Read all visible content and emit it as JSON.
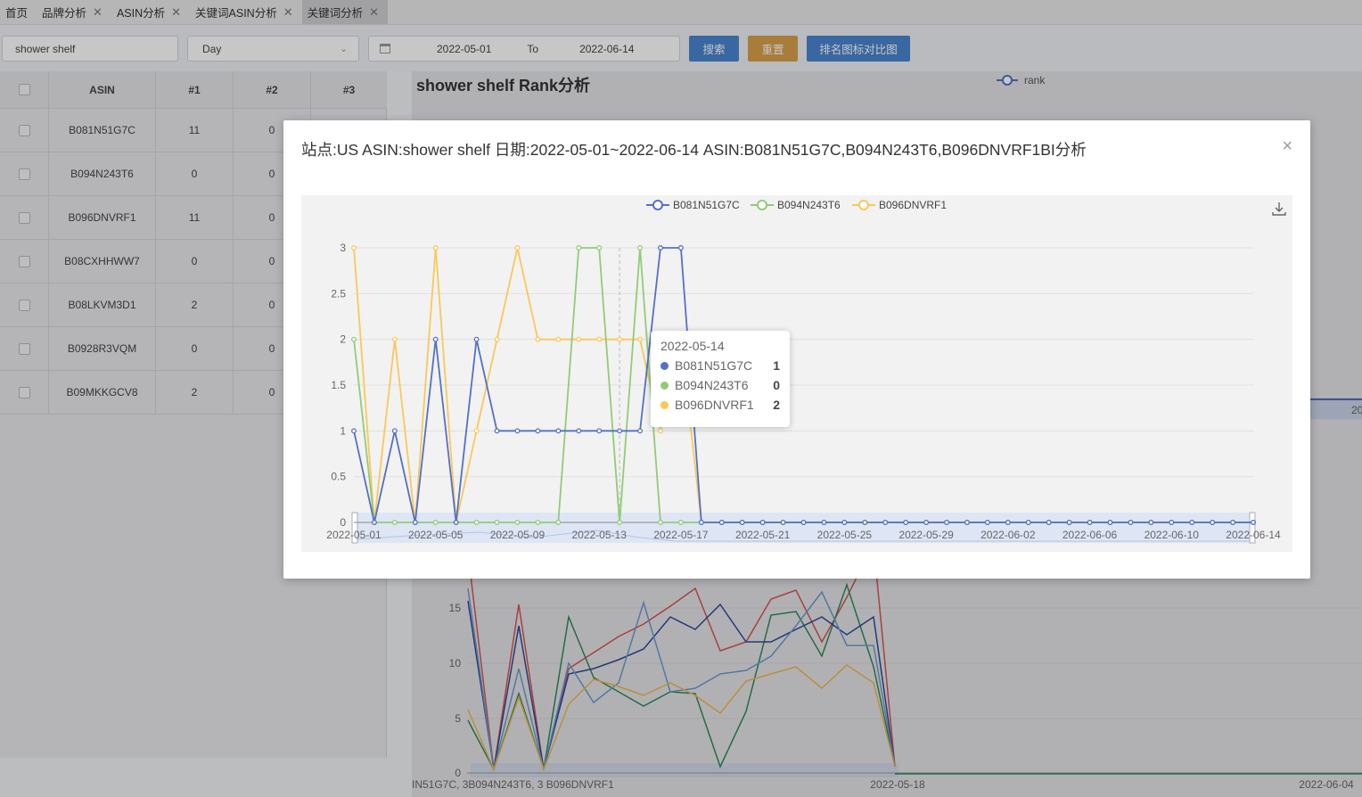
{
  "tabs": [
    {
      "label": "首页",
      "closable": false,
      "active": false
    },
    {
      "label": "品牌分析",
      "closable": true,
      "active": false
    },
    {
      "label": "ASIN分析",
      "closable": true,
      "active": false
    },
    {
      "label": "关键词ASIN分析",
      "closable": true,
      "active": false
    },
    {
      "label": "关键词分析",
      "closable": true,
      "active": true
    }
  ],
  "toolbar": {
    "keyword": "shower shelf",
    "granularity": "Day",
    "date_start": "2022-05-01",
    "date_sep": "To",
    "date_end": "2022-06-14",
    "search_label": "搜索",
    "reset_label": "重置",
    "compare_label": "排名图标对比图"
  },
  "table": {
    "headers": [
      "ASIN",
      "#1",
      "#2",
      "#3"
    ],
    "rows": [
      [
        "B081N51G7C",
        "11",
        "0"
      ],
      [
        "B094N243T6",
        "0",
        "0"
      ],
      [
        "B096DNVRF1",
        "11",
        "0"
      ],
      [
        "B08CXHHWW7",
        "0",
        "0"
      ],
      [
        "B08LKVM3D1",
        "2",
        "0"
      ],
      [
        "B0928R3VQM",
        "0",
        "0"
      ],
      [
        "B09MKKGCV8",
        "2",
        "0"
      ]
    ]
  },
  "background_chart": {
    "title": "shower shelf Rank分析",
    "legend": "rank",
    "y_ticks": [
      "15",
      "10",
      "5",
      "0"
    ],
    "x_ticks": [
      "2022-05-18",
      "2022-06-04"
    ],
    "x_partial_label": "IN51G7C, 3B094N243T6, 3 B096DNVRF1",
    "edge_label": "20"
  },
  "modal": {
    "title": "站点:US ASIN:shower shelf 日期:2022-05-01~2022-06-14 ASIN:B081N51G7C,B094N243T6,B096DNVRF1BI分析",
    "close_label": "×"
  },
  "tooltip": {
    "date": "2022-05-14",
    "items": [
      {
        "name": "B081N51G7C",
        "value": "1",
        "color": "#5470c6"
      },
      {
        "name": "B094N243T6",
        "value": "0",
        "color": "#91cc75"
      },
      {
        "name": "B096DNVRF1",
        "value": "2",
        "color": "#fac858"
      }
    ]
  },
  "chart_data": {
    "type": "line",
    "title": "",
    "xlabel": "",
    "ylabel": "",
    "ylim": [
      0,
      3
    ],
    "y_ticks": [
      0,
      0.5,
      1,
      1.5,
      2,
      2.5,
      3
    ],
    "x_tick_labels": [
      "2022-05-01",
      "2022-05-05",
      "2022-05-09",
      "2022-05-13",
      "2022-05-17",
      "2022-05-21",
      "2022-05-25",
      "2022-05-29",
      "2022-06-02",
      "2022-06-06",
      "2022-06-10",
      "2022-06-14"
    ],
    "x": [
      "2022-05-01",
      "2022-05-02",
      "2022-05-03",
      "2022-05-04",
      "2022-05-05",
      "2022-05-06",
      "2022-05-07",
      "2022-05-08",
      "2022-05-09",
      "2022-05-10",
      "2022-05-11",
      "2022-05-12",
      "2022-05-13",
      "2022-05-14",
      "2022-05-15",
      "2022-05-16",
      "2022-05-17",
      "2022-05-18",
      "2022-05-19",
      "2022-05-20",
      "2022-05-21",
      "2022-05-22",
      "2022-05-23",
      "2022-05-24",
      "2022-05-25",
      "2022-05-26",
      "2022-05-27",
      "2022-05-28",
      "2022-05-29",
      "2022-05-30",
      "2022-05-31",
      "2022-06-01",
      "2022-06-02",
      "2022-06-03",
      "2022-06-04",
      "2022-06-05",
      "2022-06-06",
      "2022-06-07",
      "2022-06-08",
      "2022-06-09",
      "2022-06-10",
      "2022-06-11",
      "2022-06-12",
      "2022-06-13",
      "2022-06-14"
    ],
    "series": [
      {
        "name": "B081N51G7C",
        "color": "#5470c6",
        "values": [
          1,
          0,
          1,
          0,
          2,
          0,
          2,
          1,
          1,
          1,
          1,
          1,
          1,
          1,
          1,
          3,
          3,
          0,
          0,
          0,
          0,
          0,
          0,
          0,
          0,
          0,
          0,
          0,
          0,
          0,
          0,
          0,
          0,
          0,
          0,
          0,
          0,
          0,
          0,
          0,
          0,
          0,
          0,
          0,
          0
        ]
      },
      {
        "name": "B094N243T6",
        "color": "#91cc75",
        "values": [
          2,
          0,
          0,
          0,
          0,
          0,
          0,
          0,
          0,
          0,
          0,
          3,
          3,
          0,
          3,
          0,
          0,
          0,
          0,
          0,
          0,
          0,
          0,
          0,
          0,
          0,
          0,
          0,
          0,
          0,
          0,
          0,
          0,
          0,
          0,
          0,
          0,
          0,
          0,
          0,
          0,
          0,
          0,
          0,
          0
        ]
      },
      {
        "name": "B096DNVRF1",
        "color": "#fac858",
        "values": [
          3,
          0,
          2,
          0,
          3,
          0,
          1,
          2,
          3,
          2,
          2,
          2,
          2,
          2,
          2,
          1,
          2,
          0,
          0,
          0,
          0,
          0,
          0,
          0,
          0,
          0,
          0,
          0,
          0,
          0,
          0,
          0,
          0,
          0,
          0,
          0,
          0,
          0,
          0,
          0,
          0,
          0,
          0,
          0,
          0
        ]
      }
    ],
    "legend_position": "top-center",
    "grid": true
  }
}
